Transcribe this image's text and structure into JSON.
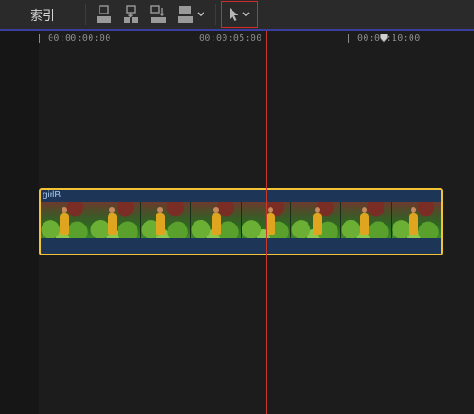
{
  "toolbar": {
    "index_label": "索引",
    "tools": [
      {
        "icon": "append-clip-icon"
      },
      {
        "icon": "insert-clip-icon"
      },
      {
        "icon": "connect-clip-icon"
      },
      {
        "icon": "overwrite-clip-icon"
      }
    ],
    "edit_options_chevron": "chevron-down-icon",
    "select_tool": {
      "icon": "arrow-select-icon",
      "chevron": "chevron-down-icon"
    }
  },
  "ruler": {
    "ticks": [
      "00:00:00:00",
      "00:00:05:00",
      "00:00:10:00"
    ]
  },
  "clip": {
    "name": "girlB",
    "frames": 8
  },
  "colors": {
    "clip_border": "#f2c335",
    "clip_fill": "#1d3556",
    "skimmer": "#c8392b",
    "playhead": "#c8c8c8",
    "select_tool_highlight": "#d22a2a"
  }
}
